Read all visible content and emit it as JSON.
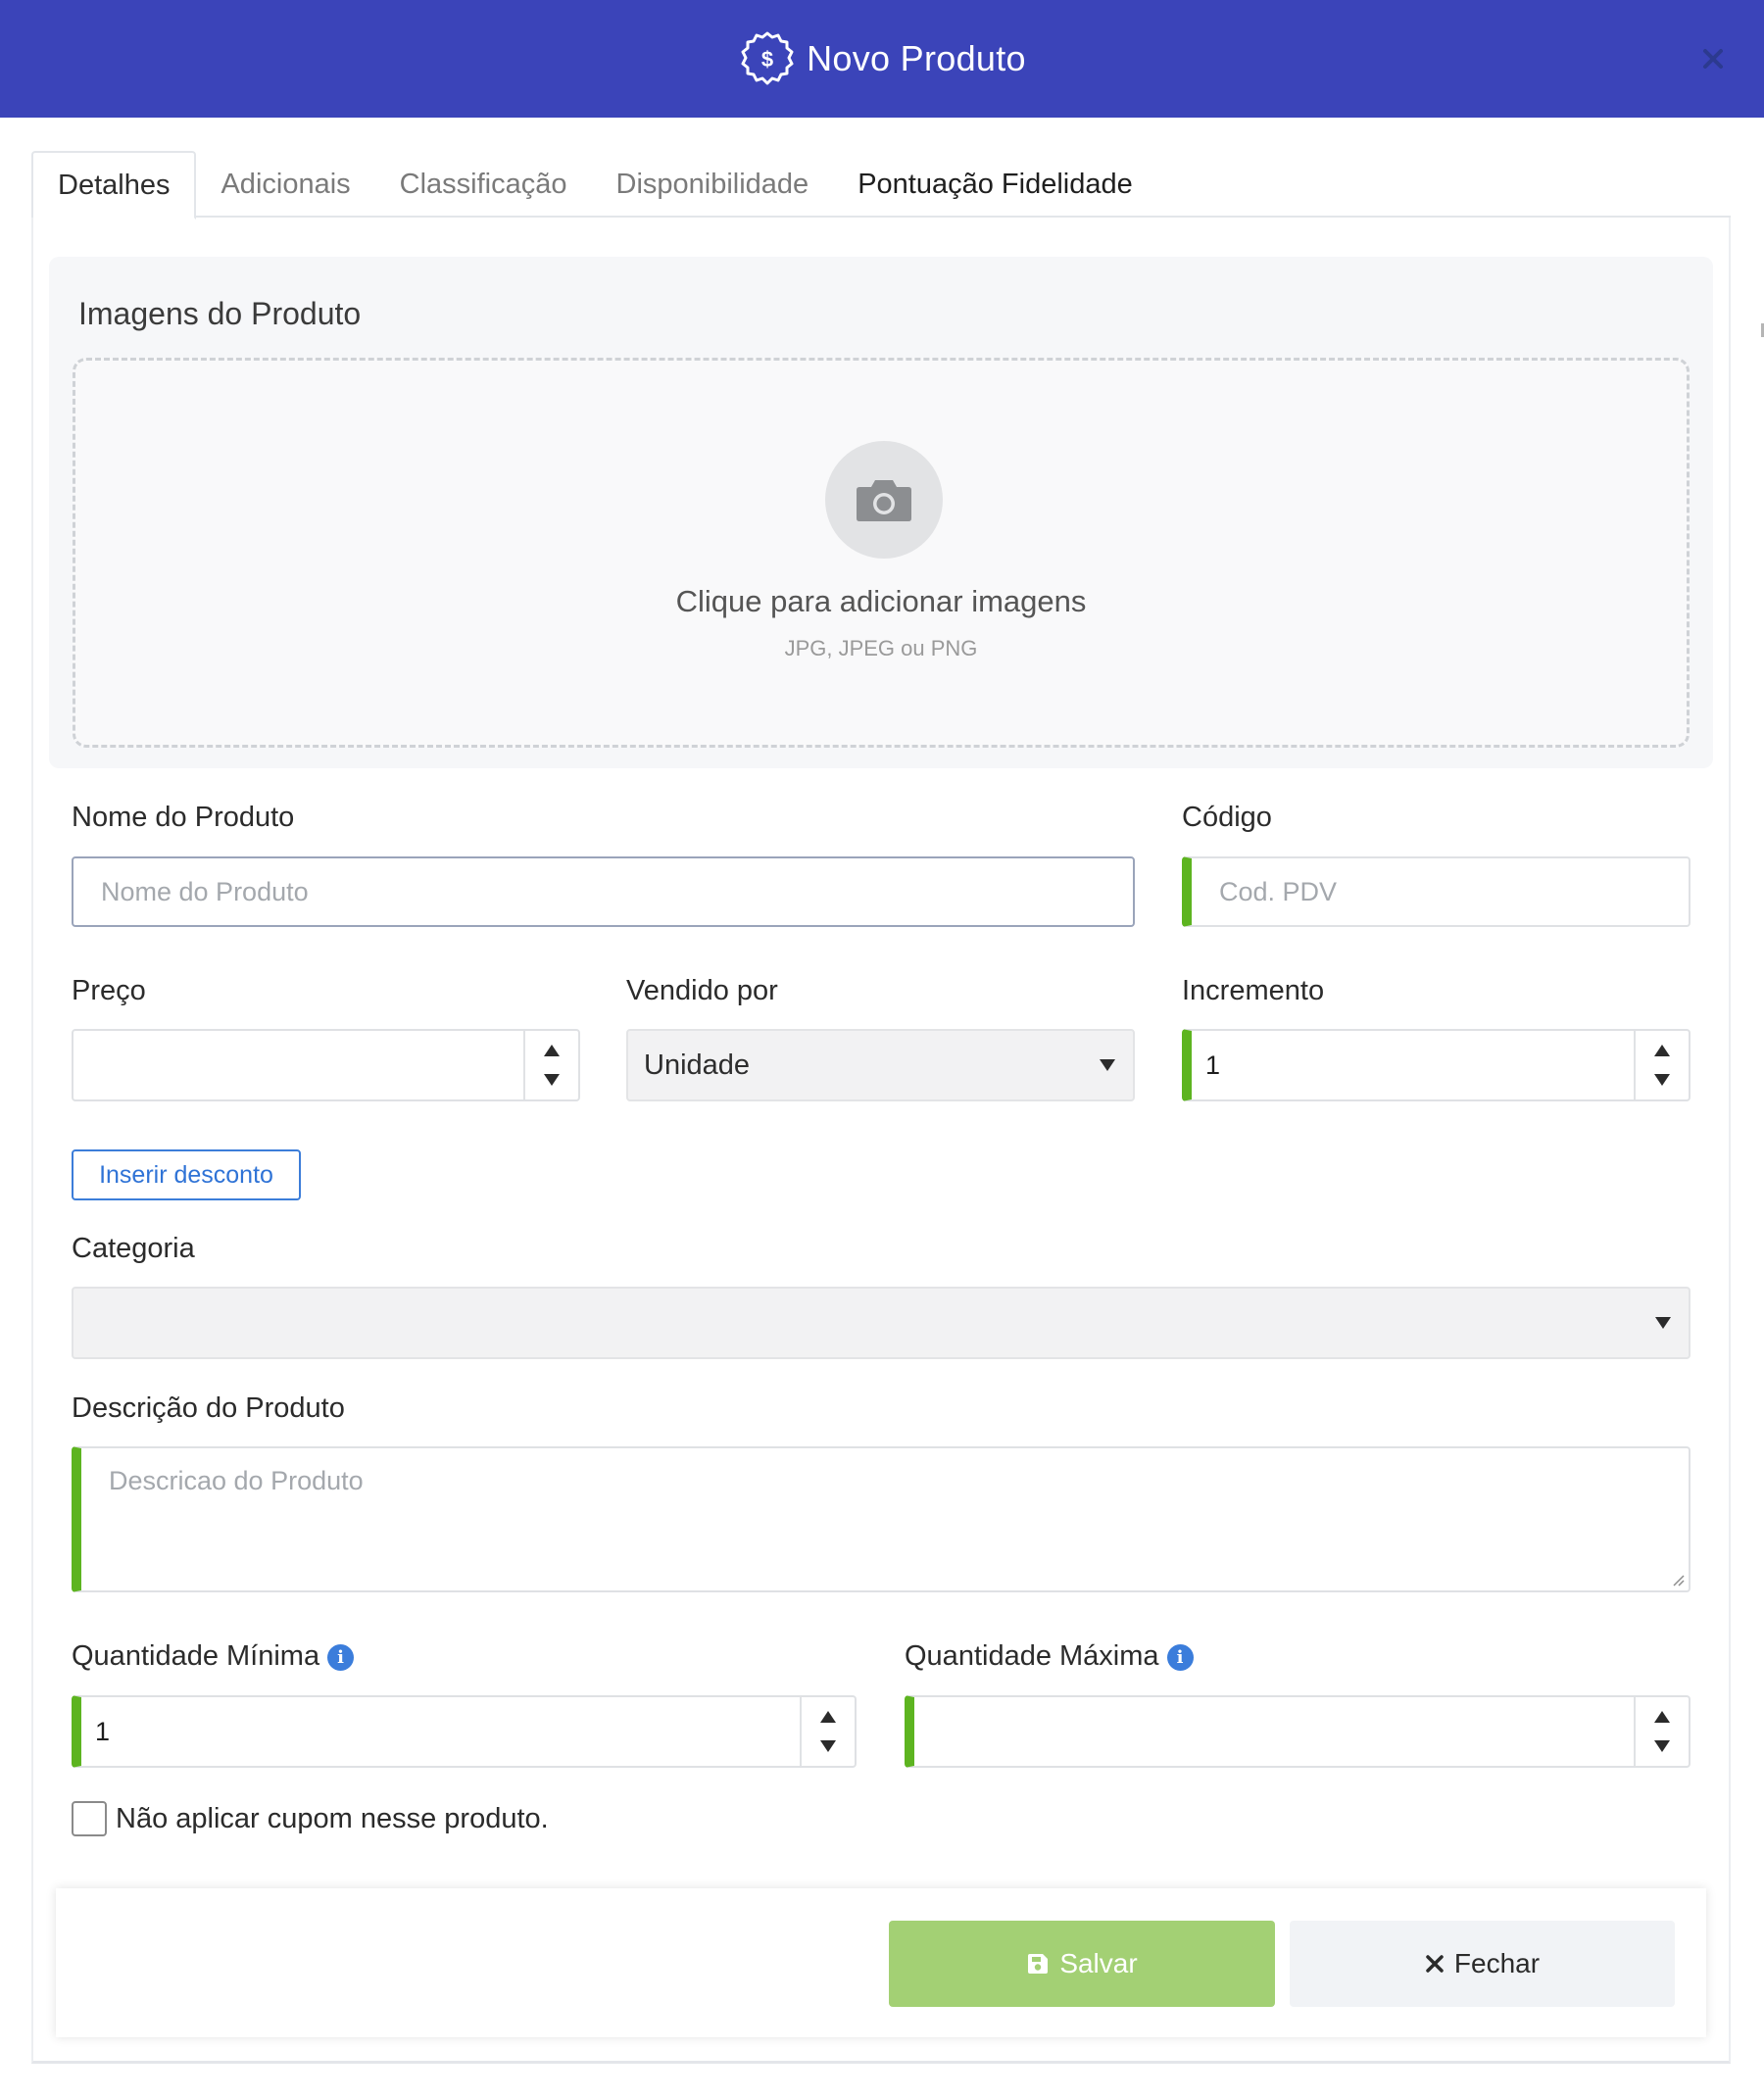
{
  "header": {
    "title": "Novo Produto",
    "badge_icon": "dollar-badge-icon",
    "close_icon": "close-icon"
  },
  "tabs": [
    {
      "label": "Detalhes",
      "active": true
    },
    {
      "label": "Adicionais",
      "active": false
    },
    {
      "label": "Classificação",
      "active": false
    },
    {
      "label": "Disponibilidade",
      "active": false
    },
    {
      "label": "Pontuação Fidelidade",
      "active": false
    }
  ],
  "images": {
    "section_title": "Imagens do Produto",
    "dropzone_title": "Clique para adicionar imagens",
    "dropzone_subtitle": "JPG, JPEG ou PNG",
    "icon": "camera-icon"
  },
  "form": {
    "nome": {
      "label": "Nome do Produto",
      "placeholder": "Nome do Produto",
      "value": ""
    },
    "codigo": {
      "label": "Código",
      "placeholder": "Cod. PDV",
      "value": ""
    },
    "preco": {
      "label": "Preço",
      "value": ""
    },
    "vendido_por": {
      "label": "Vendido por",
      "selected": "Unidade"
    },
    "incremento": {
      "label": "Incremento",
      "value": "1"
    },
    "desconto_button": "Inserir desconto",
    "categoria": {
      "label": "Categoria",
      "selected": ""
    },
    "descricao": {
      "label": "Descrição do Produto",
      "placeholder": "Descricao do Produto",
      "value": ""
    },
    "quantidade_minima": {
      "label": "Quantidade Mínima",
      "value": "1"
    },
    "quantidade_maxima": {
      "label": "Quantidade Máxima",
      "value": ""
    },
    "cupom_checkbox": {
      "label": "Não aplicar cupom nesse produto.",
      "checked": false
    }
  },
  "footer": {
    "save_label": "Salvar",
    "close_label": "Fechar"
  },
  "colors": {
    "header": "#3b44b9",
    "required_accent": "#5db420",
    "save_button": "#a3d074",
    "link_blue": "#3c7dd9"
  }
}
